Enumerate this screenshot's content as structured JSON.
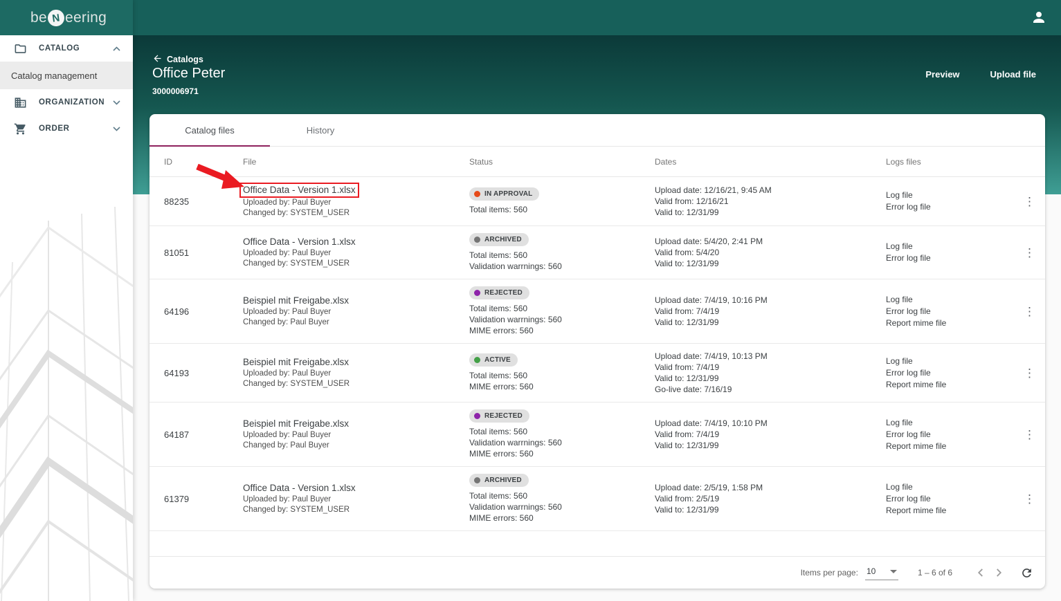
{
  "colors": {
    "topbar_teal": "#17605a",
    "logo_teal": "#1d6a63",
    "hero_gradient_top": "#0b3a39",
    "hero_gradient_bottom": "#3f9e94",
    "tab_underline": "#8e215d",
    "annotation_red": "#ea1b22",
    "status": {
      "in_approval": "#e64a19",
      "archived": "#757575",
      "rejected": "#8e24aa",
      "active": "#43a047"
    }
  },
  "brand": {
    "name": "beNeering",
    "prefix": "be",
    "emblem": "N",
    "suffix": "eering"
  },
  "sidebar": {
    "sections": [
      {
        "label": "CATALOG",
        "icon": "folder-icon",
        "chevron": "up"
      },
      {
        "label": "ORGANIZATION",
        "icon": "organization-icon",
        "chevron": "down"
      },
      {
        "label": "ORDER",
        "icon": "cart-icon",
        "chevron": "down"
      }
    ],
    "active_subitem": "Catalog management"
  },
  "header": {
    "back": "Catalogs",
    "title": "Office Peter",
    "subtitle": "3000006971",
    "actions": [
      {
        "label": "Preview"
      },
      {
        "label": "Upload file"
      }
    ]
  },
  "tabs": [
    {
      "label": "Catalog files",
      "active": true
    },
    {
      "label": "History",
      "active": false
    }
  ],
  "table": {
    "columns": [
      "ID",
      "File",
      "Status",
      "Dates",
      "Logs files"
    ],
    "rows": [
      {
        "id": "88235",
        "file": "Office Data - Version 1.xlsx",
        "uploaded_by": "Uploaded by: Paul Buyer",
        "changed_by": "Changed by: SYSTEM_USER",
        "status_label": "IN APPROVAL",
        "stats": [
          "Total items: 560"
        ],
        "dates": [
          "Upload date: 12/16/21, 9:45 AM",
          "Valid from: 12/16/21",
          "Valid to: 12/31/99"
        ],
        "logs": [
          "Log file",
          "Error log file"
        ],
        "annotated": true
      },
      {
        "id": "81051",
        "file": "Office Data - Version 1.xlsx",
        "uploaded_by": "Uploaded by: Paul Buyer",
        "changed_by": "Changed by: SYSTEM_USER",
        "status_label": "ARCHIVED",
        "stats": [
          "Total items: 560",
          "Validation warrnings: 560"
        ],
        "dates": [
          "Upload date: 5/4/20, 2:41 PM",
          "Valid from: 5/4/20",
          "Valid to: 12/31/99"
        ],
        "logs": [
          "Log file",
          "Error log file"
        ],
        "annotated": false
      },
      {
        "id": "64196",
        "file": "Beispiel mit Freigabe.xlsx",
        "uploaded_by": "Uploaded by: Paul Buyer",
        "changed_by": "Changed by: Paul Buyer",
        "status_label": "REJECTED",
        "stats": [
          "Total items: 560",
          "Validation warrnings: 560",
          "MIME errors: 560"
        ],
        "dates": [
          "Upload date: 7/4/19, 10:16 PM",
          "Valid from: 7/4/19",
          "Valid to: 12/31/99"
        ],
        "logs": [
          "Log file",
          "Error log file",
          "Report mime file"
        ],
        "annotated": false
      },
      {
        "id": "64193",
        "file": "Beispiel mit Freigabe.xlsx",
        "uploaded_by": "Uploaded by: Paul Buyer",
        "changed_by": "Changed by: SYSTEM_USER",
        "status_label": "ACTIVE",
        "stats": [
          "Total items: 560",
          "MIME errors: 560"
        ],
        "dates": [
          "Upload date: 7/4/19, 10:13 PM",
          "Valid from: 7/4/19",
          "Valid to: 12/31/99",
          "Go-live date: 7/16/19"
        ],
        "logs": [
          "Log file",
          "Error log file",
          "Report mime file"
        ],
        "annotated": false
      },
      {
        "id": "64187",
        "file": "Beispiel mit Freigabe.xlsx",
        "uploaded_by": "Uploaded by: Paul Buyer",
        "changed_by": "Changed by: Paul Buyer",
        "status_label": "REJECTED",
        "stats": [
          "Total items: 560",
          "Validation warrnings: 560",
          "MIME errors: 560"
        ],
        "dates": [
          "Upload date: 7/4/19, 10:10 PM",
          "Valid from: 7/4/19",
          "Valid to: 12/31/99"
        ],
        "logs": [
          "Log file",
          "Error log file",
          "Report mime file"
        ],
        "annotated": false
      },
      {
        "id": "61379",
        "file": "Office Data - Version 1.xlsx",
        "uploaded_by": "Uploaded by: Paul Buyer",
        "changed_by": "Changed by: SYSTEM_USER",
        "status_label": "ARCHIVED",
        "stats": [
          "Total items: 560",
          "Validation warrnings: 560",
          "MIME errors: 560"
        ],
        "dates": [
          "Upload date: 2/5/19, 1:58 PM",
          "Valid from: 2/5/19",
          "Valid to: 12/31/99"
        ],
        "logs": [
          "Log file",
          "Error log file",
          "Report mime file"
        ],
        "annotated": false
      }
    ]
  },
  "pagination": {
    "items_per_page_label": "Items per page:",
    "page_size": "10",
    "range": "1 – 6 of 6"
  }
}
